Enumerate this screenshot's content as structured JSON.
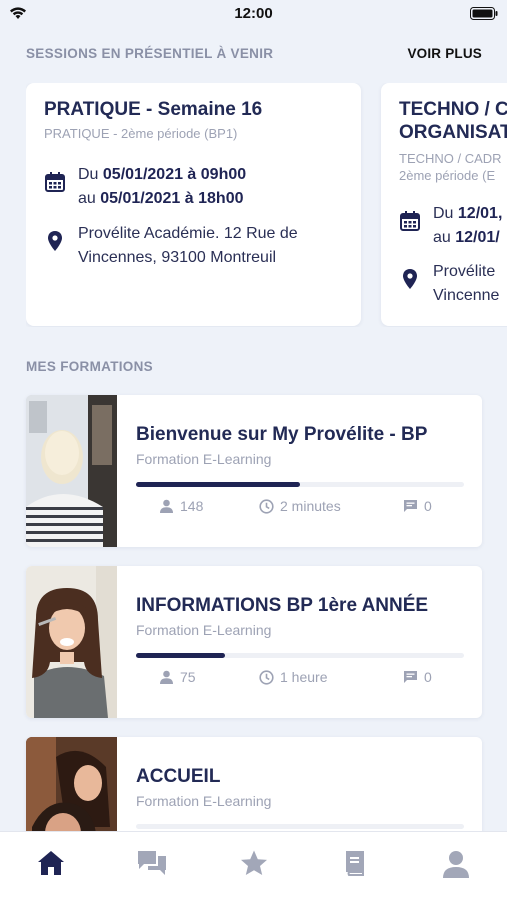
{
  "status_bar": {
    "time": "12:00"
  },
  "sessions_section": {
    "title": "SESSIONS EN PRÉSENTIEL À VENIR",
    "see_more": "VOIR PLUS",
    "cards": [
      {
        "title": "PRATIQUE - Semaine 16",
        "subtitle": "PRATIQUE - 2ème période (BP1)",
        "date_from_prefix": "Du ",
        "date_from": "05/01/2021 à 09h00",
        "date_to_prefix": "au ",
        "date_to": "05/01/2021 à 18h00",
        "location_line1": "Provélite Académie. 12 Rue de",
        "location_line2": "Vincennes, 93100 Montreuil"
      },
      {
        "title_line1": "TECHNO / C",
        "title_line2": "ORGANISAT",
        "subtitle_line1": "TECHNO / CADR",
        "subtitle_line2": "2ème période (E",
        "date_from_prefix": "Du ",
        "date_from": "12/01,",
        "date_to_prefix": "au ",
        "date_to": "12/01/",
        "location_line1": "Provélite",
        "location_line2": "Vincenne"
      }
    ]
  },
  "formations_section": {
    "title": "MES FORMATIONS",
    "items": [
      {
        "title": "Bienvenue sur My Provélite - BP",
        "type": "Formation E-Learning",
        "progress": 0.5,
        "learners": "148",
        "duration": "2 minutes",
        "comments": "0"
      },
      {
        "title": "INFORMATIONS BP 1ère ANNÉE",
        "type": "Formation E-Learning",
        "progress": 0.27,
        "learners": "75",
        "duration": "1 heure",
        "comments": "0"
      },
      {
        "title": "ACCUEIL",
        "type": "Formation E-Learning",
        "progress": 0,
        "learners": "",
        "duration": "",
        "comments": ""
      }
    ]
  },
  "tab_bar": {
    "items": [
      {
        "icon": "home-icon",
        "active": true
      },
      {
        "icon": "chat-icon",
        "active": false
      },
      {
        "icon": "star-icon",
        "active": false
      },
      {
        "icon": "book-icon",
        "active": false
      },
      {
        "icon": "user-icon",
        "active": false
      }
    ]
  },
  "colors": {
    "accent": "#1f2454",
    "muted": "#9da2b4",
    "background": "#eef2f9"
  }
}
